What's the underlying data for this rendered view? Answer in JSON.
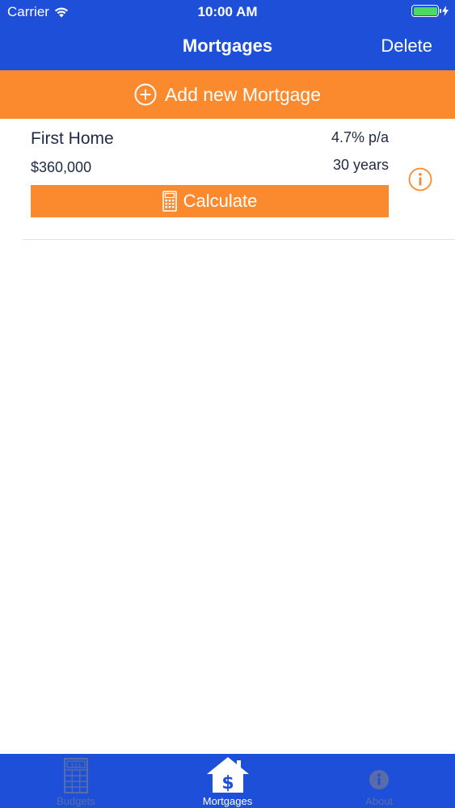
{
  "status_bar": {
    "carrier": "Carrier",
    "time": "10:00 AM",
    "battery_color": "#4cd964"
  },
  "nav": {
    "title": "Mortgages",
    "delete_label": "Delete",
    "background_color": "#1d4fd8"
  },
  "add_bar": {
    "label": "Add new Mortgage",
    "icon": "plus-circle-icon",
    "background_color": "#fb8a2f"
  },
  "mortgages": [
    {
      "name": "First Home",
      "amount": "$360,000",
      "rate": "4.7% p/a",
      "term": "30 years",
      "calculate_label": "Calculate",
      "calculate_icon": "calculator-icon",
      "info_icon": "info-icon"
    }
  ],
  "tab_bar": {
    "tabs": [
      {
        "label": "Budgets",
        "icon": "budgets-grid-icon",
        "active": false
      },
      {
        "label": "Mortgages",
        "icon": "house-dollar-icon",
        "active": true
      },
      {
        "label": "About",
        "icon": "info-icon",
        "active": false
      }
    ]
  }
}
